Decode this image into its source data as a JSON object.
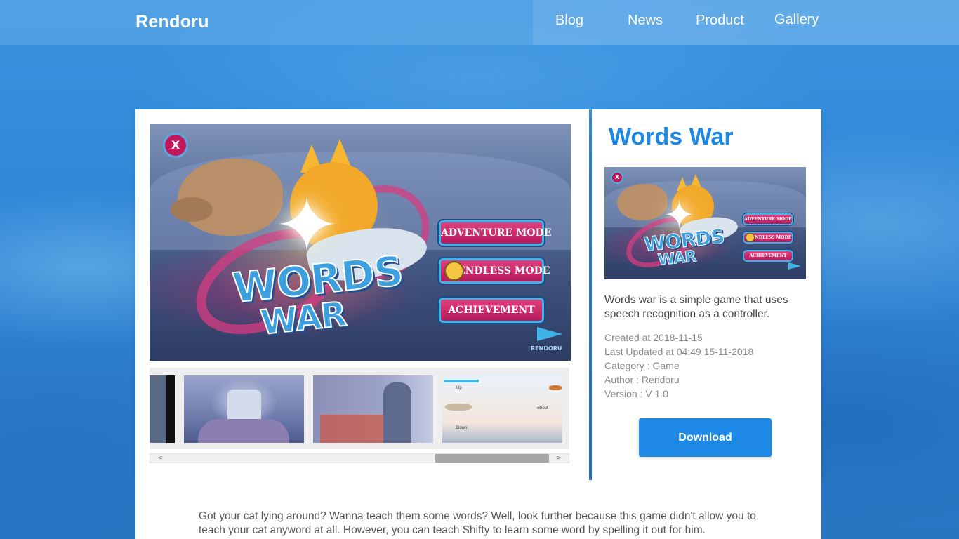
{
  "nav": {
    "brand": "Rendoru",
    "links": [
      "Blog",
      "News",
      "Product",
      "Gallery"
    ]
  },
  "game_art": {
    "logo_line1": "WORDS",
    "logo_line2": "WAR",
    "close_label": "X",
    "menu": [
      "ADVENTURE MODE",
      "ENDLESS MODE",
      "ACHIEVEMENT"
    ],
    "watermark": "RENDORU"
  },
  "thumbnails": {
    "items": [
      "thumb-dark",
      "thumb-throne",
      "thumb-city",
      "thumb-plane"
    ],
    "plane_labels": {
      "up": "Up",
      "down": "Down",
      "shoot": "Shoot"
    },
    "scroll_left": "<",
    "scroll_right": ">",
    "scroll_position": 0.75
  },
  "info": {
    "title": "Words War",
    "description": "Words war is a simple game that uses speech recognition as a controller.",
    "created": "Created at 2018-11-15",
    "updated": "Last Updated at 04:49 15-11-2018",
    "category": "Category : Game",
    "author": "Author : Rendoru",
    "version": "Version : V 1.0",
    "download_label": "Download"
  },
  "long_description": "Got your cat lying around? Wanna teach them some words? Well, look further because this game didn't allow you to teach your cat anyword at all. However, you can teach Shifty to learn some word by spelling it out for him.",
  "colors": {
    "accent": "#1e88e5",
    "background": "#2f86d6",
    "menu_button": "#c2185b"
  }
}
